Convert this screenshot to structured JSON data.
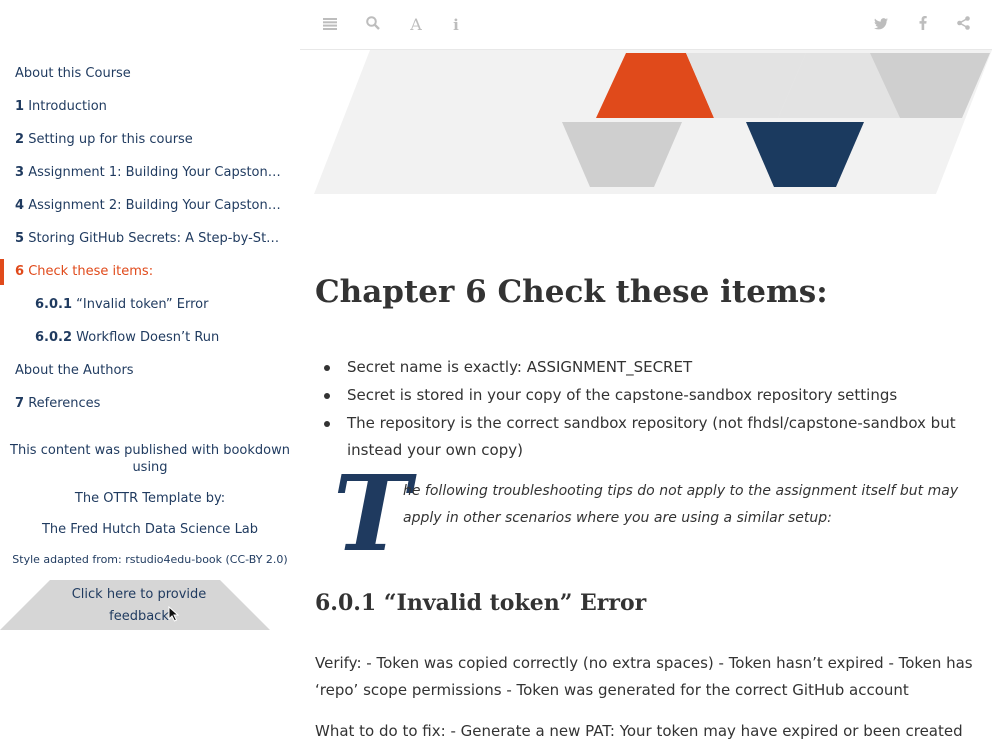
{
  "sidebar": {
    "toc": [
      {
        "num": "",
        "label": "About this Course",
        "active": false,
        "sub": false
      },
      {
        "num": "1",
        "label": "Introduction",
        "active": false,
        "sub": false
      },
      {
        "num": "2",
        "label": "Setting up for this course",
        "active": false,
        "sub": false
      },
      {
        "num": "3",
        "label": "Assignment 1: Building Your Capstone …",
        "active": false,
        "sub": false
      },
      {
        "num": "4",
        "label": "Assignment 2: Building Your Capstone …",
        "active": false,
        "sub": false
      },
      {
        "num": "5",
        "label": "Storing GitHub Secrets: A Step-by-Step …",
        "active": false,
        "sub": false
      },
      {
        "num": "6",
        "label": "Check these items:",
        "active": true,
        "sub": false
      },
      {
        "num": "6.0.1",
        "label": "“Invalid token” Error",
        "active": false,
        "sub": true
      },
      {
        "num": "6.0.2",
        "label": "Workflow Doesn’t Run",
        "active": false,
        "sub": true
      },
      {
        "num": "",
        "label": "About the Authors",
        "active": false,
        "sub": false
      },
      {
        "num": "7",
        "label": "References",
        "active": false,
        "sub": false
      }
    ],
    "published_with": "This content was published with bookdown using",
    "template_by": "The OTTR Template by:",
    "lab": "The Fred Hutch Data Science Lab",
    "style_adapted": "Style adapted from: rstudio4edu-book (CC-BY 2.0)",
    "feedback": "Click here to provide feedback"
  },
  "toolbar": {
    "left_icons": [
      "menu-icon",
      "search-icon",
      "font-icon",
      "info-icon"
    ],
    "right_icons": [
      "twitter-icon",
      "facebook-icon",
      "share-icon"
    ]
  },
  "banner": {
    "colors": {
      "orange": "#e04a1b",
      "navy": "#1b3a5f",
      "light": "#e3e3e3",
      "mid": "#cfcfcf",
      "band": "#f2f2f2"
    }
  },
  "main": {
    "chapter_title": "Chapter 6   Check these items:",
    "bullets": [
      "Secret name is exactly: ASSIGNMENT_SECRET",
      "Secret is stored in your copy of the capstone-sandbox repository settings",
      "The repository is the correct sandbox repository (not fhdsl/capstone-sandbox but instead your own copy)"
    ],
    "dropcap": "T",
    "tips": "he following troubleshooting tips do not apply to the assignment itself but may apply in other scenarios where you are using a similar setup:",
    "section_title": "6.0.1   “Invalid token” Error",
    "verify": "Verify: - Token was copied correctly (no extra spaces) - Token hasn’t expired - Token has ‘repo’ scope permissions - Token was generated for the correct GitHub account",
    "fix": "What to do to fix: - Generate a new PAT: Your token may have expired or been created"
  }
}
